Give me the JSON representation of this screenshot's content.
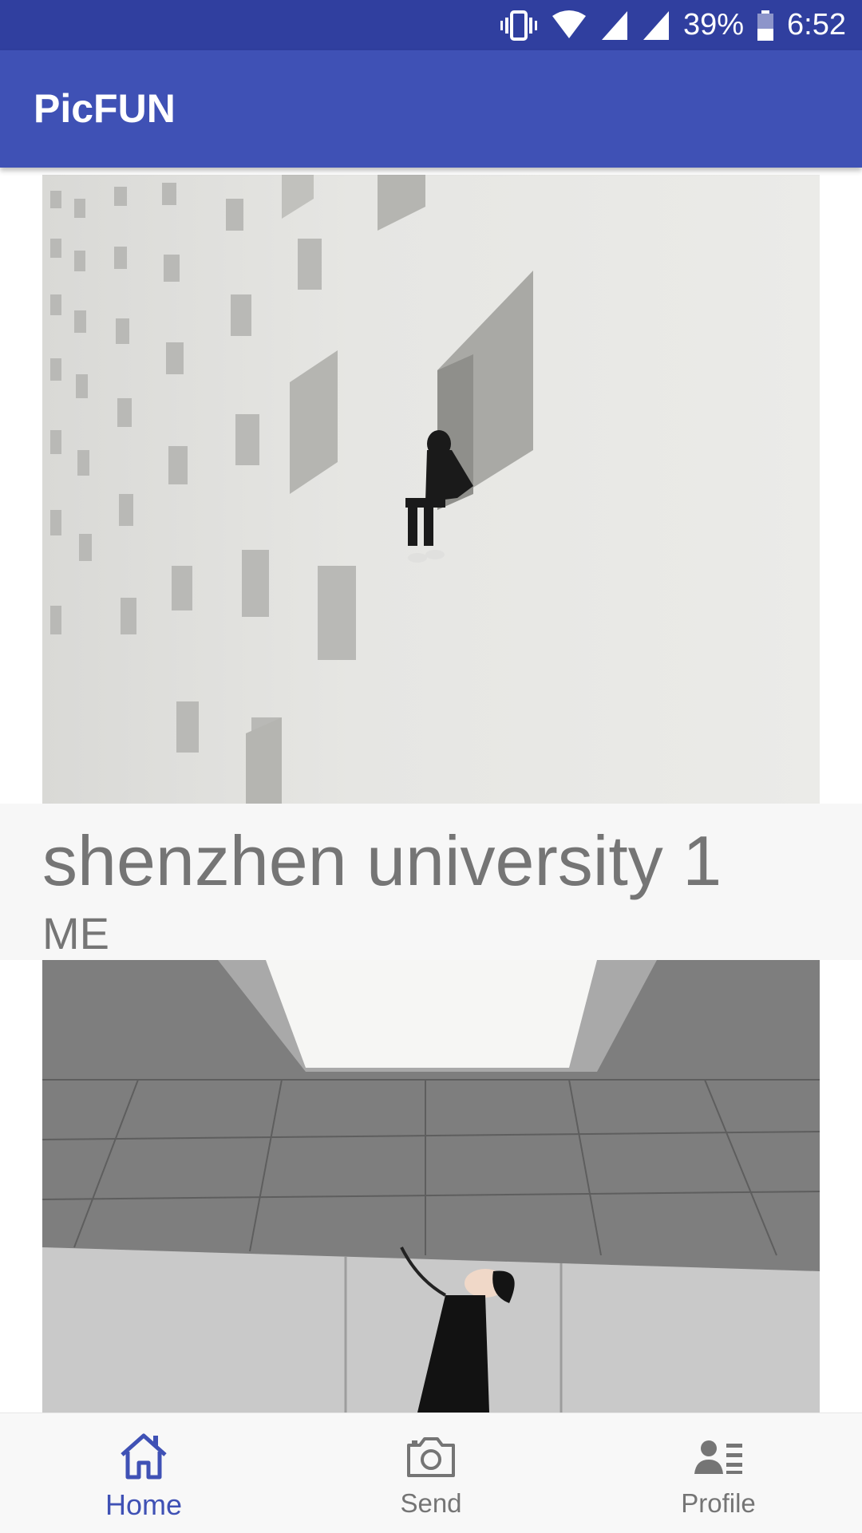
{
  "status_bar": {
    "battery": "39%",
    "time": "6:52",
    "icons": [
      "vibrate-icon",
      "wifi-icon",
      "signal-icon",
      "signal-icon",
      "battery-icon"
    ]
  },
  "app_bar": {
    "title": "PicFUN"
  },
  "feed": {
    "posts": [
      {
        "image": "photo-person-sitting-in-window-of-white-building",
        "title": "shenzhen university 1",
        "author": "ME"
      },
      {
        "image": "photo-person-looking-up-at-skylight"
      }
    ]
  },
  "bottom_nav": {
    "items": [
      {
        "label": "Home",
        "icon": "home-icon",
        "active": true
      },
      {
        "label": "Send",
        "icon": "camera-icon",
        "active": false
      },
      {
        "label": "Profile",
        "icon": "profile-icon",
        "active": false
      }
    ]
  },
  "colors": {
    "status_bar": "#303F9F",
    "app_bar": "#3F51B5",
    "accent": "#3F51B5",
    "caption_bg": "#F7F7F7",
    "caption_text": "#757575",
    "nav_inactive": "#757575"
  }
}
